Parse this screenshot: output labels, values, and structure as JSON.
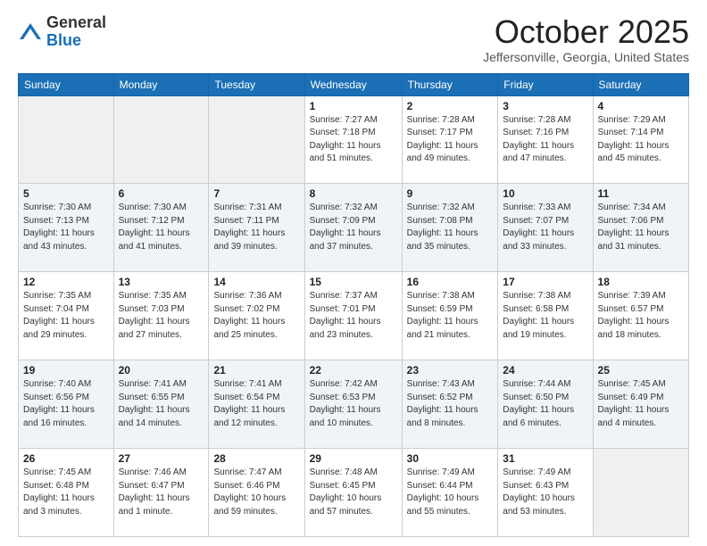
{
  "logo": {
    "general": "General",
    "blue": "Blue"
  },
  "header": {
    "month": "October 2025",
    "location": "Jeffersonville, Georgia, United States"
  },
  "weekdays": [
    "Sunday",
    "Monday",
    "Tuesday",
    "Wednesday",
    "Thursday",
    "Friday",
    "Saturday"
  ],
  "weeks": [
    [
      {
        "day": "",
        "info": ""
      },
      {
        "day": "",
        "info": ""
      },
      {
        "day": "",
        "info": ""
      },
      {
        "day": "1",
        "info": "Sunrise: 7:27 AM\nSunset: 7:18 PM\nDaylight: 11 hours\nand 51 minutes."
      },
      {
        "day": "2",
        "info": "Sunrise: 7:28 AM\nSunset: 7:17 PM\nDaylight: 11 hours\nand 49 minutes."
      },
      {
        "day": "3",
        "info": "Sunrise: 7:28 AM\nSunset: 7:16 PM\nDaylight: 11 hours\nand 47 minutes."
      },
      {
        "day": "4",
        "info": "Sunrise: 7:29 AM\nSunset: 7:14 PM\nDaylight: 11 hours\nand 45 minutes."
      }
    ],
    [
      {
        "day": "5",
        "info": "Sunrise: 7:30 AM\nSunset: 7:13 PM\nDaylight: 11 hours\nand 43 minutes."
      },
      {
        "day": "6",
        "info": "Sunrise: 7:30 AM\nSunset: 7:12 PM\nDaylight: 11 hours\nand 41 minutes."
      },
      {
        "day": "7",
        "info": "Sunrise: 7:31 AM\nSunset: 7:11 PM\nDaylight: 11 hours\nand 39 minutes."
      },
      {
        "day": "8",
        "info": "Sunrise: 7:32 AM\nSunset: 7:09 PM\nDaylight: 11 hours\nand 37 minutes."
      },
      {
        "day": "9",
        "info": "Sunrise: 7:32 AM\nSunset: 7:08 PM\nDaylight: 11 hours\nand 35 minutes."
      },
      {
        "day": "10",
        "info": "Sunrise: 7:33 AM\nSunset: 7:07 PM\nDaylight: 11 hours\nand 33 minutes."
      },
      {
        "day": "11",
        "info": "Sunrise: 7:34 AM\nSunset: 7:06 PM\nDaylight: 11 hours\nand 31 minutes."
      }
    ],
    [
      {
        "day": "12",
        "info": "Sunrise: 7:35 AM\nSunset: 7:04 PM\nDaylight: 11 hours\nand 29 minutes."
      },
      {
        "day": "13",
        "info": "Sunrise: 7:35 AM\nSunset: 7:03 PM\nDaylight: 11 hours\nand 27 minutes."
      },
      {
        "day": "14",
        "info": "Sunrise: 7:36 AM\nSunset: 7:02 PM\nDaylight: 11 hours\nand 25 minutes."
      },
      {
        "day": "15",
        "info": "Sunrise: 7:37 AM\nSunset: 7:01 PM\nDaylight: 11 hours\nand 23 minutes."
      },
      {
        "day": "16",
        "info": "Sunrise: 7:38 AM\nSunset: 6:59 PM\nDaylight: 11 hours\nand 21 minutes."
      },
      {
        "day": "17",
        "info": "Sunrise: 7:38 AM\nSunset: 6:58 PM\nDaylight: 11 hours\nand 19 minutes."
      },
      {
        "day": "18",
        "info": "Sunrise: 7:39 AM\nSunset: 6:57 PM\nDaylight: 11 hours\nand 18 minutes."
      }
    ],
    [
      {
        "day": "19",
        "info": "Sunrise: 7:40 AM\nSunset: 6:56 PM\nDaylight: 11 hours\nand 16 minutes."
      },
      {
        "day": "20",
        "info": "Sunrise: 7:41 AM\nSunset: 6:55 PM\nDaylight: 11 hours\nand 14 minutes."
      },
      {
        "day": "21",
        "info": "Sunrise: 7:41 AM\nSunset: 6:54 PM\nDaylight: 11 hours\nand 12 minutes."
      },
      {
        "day": "22",
        "info": "Sunrise: 7:42 AM\nSunset: 6:53 PM\nDaylight: 11 hours\nand 10 minutes."
      },
      {
        "day": "23",
        "info": "Sunrise: 7:43 AM\nSunset: 6:52 PM\nDaylight: 11 hours\nand 8 minutes."
      },
      {
        "day": "24",
        "info": "Sunrise: 7:44 AM\nSunset: 6:50 PM\nDaylight: 11 hours\nand 6 minutes."
      },
      {
        "day": "25",
        "info": "Sunrise: 7:45 AM\nSunset: 6:49 PM\nDaylight: 11 hours\nand 4 minutes."
      }
    ],
    [
      {
        "day": "26",
        "info": "Sunrise: 7:45 AM\nSunset: 6:48 PM\nDaylight: 11 hours\nand 3 minutes."
      },
      {
        "day": "27",
        "info": "Sunrise: 7:46 AM\nSunset: 6:47 PM\nDaylight: 11 hours\nand 1 minute."
      },
      {
        "day": "28",
        "info": "Sunrise: 7:47 AM\nSunset: 6:46 PM\nDaylight: 10 hours\nand 59 minutes."
      },
      {
        "day": "29",
        "info": "Sunrise: 7:48 AM\nSunset: 6:45 PM\nDaylight: 10 hours\nand 57 minutes."
      },
      {
        "day": "30",
        "info": "Sunrise: 7:49 AM\nSunset: 6:44 PM\nDaylight: 10 hours\nand 55 minutes."
      },
      {
        "day": "31",
        "info": "Sunrise: 7:49 AM\nSunset: 6:43 PM\nDaylight: 10 hours\nand 53 minutes."
      },
      {
        "day": "",
        "info": ""
      }
    ]
  ]
}
